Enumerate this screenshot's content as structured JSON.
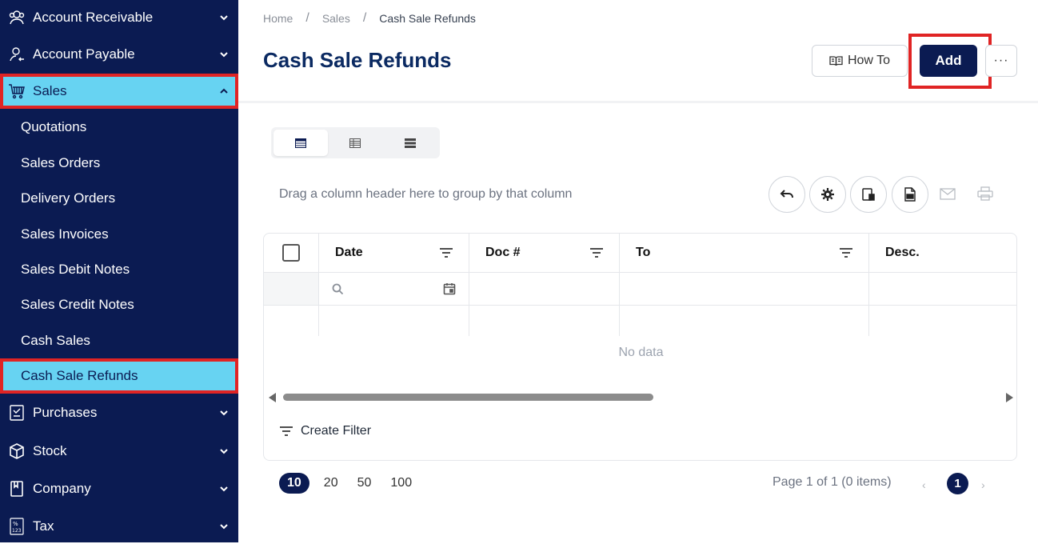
{
  "sidebar": {
    "groups_top": [
      {
        "label": "Account Receivable",
        "icon": "users-icon"
      },
      {
        "label": "Account Payable",
        "icon": "user-payable-icon"
      },
      {
        "label": "Sales",
        "icon": "cart-icon"
      }
    ],
    "sales_items": [
      {
        "label": "Quotations"
      },
      {
        "label": "Sales Orders"
      },
      {
        "label": "Delivery Orders"
      },
      {
        "label": "Sales Invoices"
      },
      {
        "label": "Sales Debit Notes"
      },
      {
        "label": "Sales Credit Notes"
      },
      {
        "label": "Cash Sales"
      },
      {
        "label": "Cash Sale Refunds"
      }
    ],
    "groups_bottom": [
      {
        "label": "Purchases",
        "icon": "purchases-icon"
      },
      {
        "label": "Stock",
        "icon": "box-icon"
      },
      {
        "label": "Company",
        "icon": "book-icon"
      },
      {
        "label": "Tax",
        "icon": "tax-icon"
      }
    ]
  },
  "breadcrumb": {
    "items": [
      "Home",
      "Sales",
      "Cash Sale Refunds"
    ],
    "separator": "/"
  },
  "page": {
    "title": "Cash Sale Refunds",
    "how_to_label": "How To",
    "add_label": "Add",
    "more_label": "···"
  },
  "grid": {
    "group_hint": "Drag a column header here to group by that column",
    "columns": [
      "Date",
      "Doc #",
      "To",
      "Desc."
    ],
    "no_data": "No data",
    "create_filter": "Create Filter"
  },
  "pager": {
    "sizes": [
      "10",
      "20",
      "50",
      "100"
    ],
    "selected_size": "10",
    "info": "Page 1 of 1 (0 items)",
    "current_page": "1",
    "prev": "‹",
    "next": "›"
  },
  "colors": {
    "sidebar_bg": "#0b1b52",
    "active_bg": "#67d3f2",
    "highlight": "#e02424",
    "primary": "#0b1b52",
    "title": "#0b2a62"
  }
}
